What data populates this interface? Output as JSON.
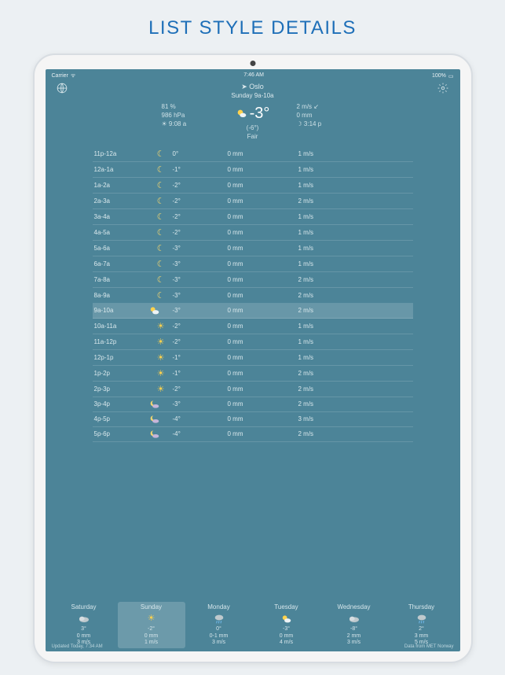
{
  "promo_title": "LIST STYLE DETAILS",
  "status_bar": {
    "carrier": "Carrier",
    "time": "7:46 AM",
    "battery": "100%"
  },
  "header": {
    "location": "Oslo",
    "period": "Sunday 9a-10a"
  },
  "summary": {
    "left": {
      "humidity": "81 %",
      "pressure": "986 hPa",
      "sunrise": "☀ 9:08 a"
    },
    "center": {
      "temp": "-3°",
      "feels": "(-6°)",
      "cond": "Fair"
    },
    "right": {
      "wind": "2 m/s ↙",
      "precip": "0 mm",
      "sunset": "☽ 3:14 p"
    }
  },
  "hours": [
    {
      "t": "11p-12a",
      "icon": "moon",
      "temp": "0°",
      "p": "0 mm",
      "w": "1 m/s"
    },
    {
      "t": "12a-1a",
      "icon": "moon",
      "temp": "-1°",
      "p": "0 mm",
      "w": "1 m/s"
    },
    {
      "t": "1a-2a",
      "icon": "moon",
      "temp": "-2°",
      "p": "0 mm",
      "w": "1 m/s"
    },
    {
      "t": "2a-3a",
      "icon": "moon",
      "temp": "-2°",
      "p": "0 mm",
      "w": "2 m/s"
    },
    {
      "t": "3a-4a",
      "icon": "moon",
      "temp": "-2°",
      "p": "0 mm",
      "w": "1 m/s"
    },
    {
      "t": "4a-5a",
      "icon": "moon",
      "temp": "-2°",
      "p": "0 mm",
      "w": "1 m/s"
    },
    {
      "t": "5a-6a",
      "icon": "moon",
      "temp": "-3°",
      "p": "0 mm",
      "w": "1 m/s"
    },
    {
      "t": "6a-7a",
      "icon": "moon",
      "temp": "-3°",
      "p": "0 mm",
      "w": "1 m/s"
    },
    {
      "t": "7a-8a",
      "icon": "moon",
      "temp": "-3°",
      "p": "0 mm",
      "w": "2 m/s"
    },
    {
      "t": "8a-9a",
      "icon": "moon",
      "temp": "-3°",
      "p": "0 mm",
      "w": "2 m/s"
    },
    {
      "t": "9a-10a",
      "icon": "suncloud",
      "temp": "-3°",
      "p": "0 mm",
      "w": "2 m/s",
      "sel": true
    },
    {
      "t": "10a-11a",
      "icon": "sun",
      "temp": "-2°",
      "p": "0 mm",
      "w": "1 m/s"
    },
    {
      "t": "11a-12p",
      "icon": "sun",
      "temp": "-2°",
      "p": "0 mm",
      "w": "1 m/s"
    },
    {
      "t": "12p-1p",
      "icon": "sun",
      "temp": "-1°",
      "p": "0 mm",
      "w": "1 m/s"
    },
    {
      "t": "1p-2p",
      "icon": "sun",
      "temp": "-1°",
      "p": "0 mm",
      "w": "2 m/s"
    },
    {
      "t": "2p-3p",
      "icon": "sun",
      "temp": "-2°",
      "p": "0 mm",
      "w": "2 m/s"
    },
    {
      "t": "3p-4p",
      "icon": "moonset",
      "temp": "-3°",
      "p": "0 mm",
      "w": "2 m/s"
    },
    {
      "t": "4p-5p",
      "icon": "moonset",
      "temp": "-4°",
      "p": "0 mm",
      "w": "3 m/s"
    },
    {
      "t": "5p-6p",
      "icon": "moonset",
      "temp": "-4°",
      "p": "0 mm",
      "w": "2 m/s"
    }
  ],
  "days": [
    {
      "name": "Saturday",
      "icon": "cloud",
      "temp": "3°",
      "p": "0 mm",
      "w": "3 m/s"
    },
    {
      "name": "Sunday",
      "icon": "sun",
      "temp": "-2°",
      "p": "0 mm",
      "w": "1 m/s",
      "sel": true
    },
    {
      "name": "Monday",
      "icon": "rain",
      "temp": "0°",
      "p": "0-1 mm",
      "w": "3 m/s"
    },
    {
      "name": "Tuesday",
      "icon": "suncloud",
      "temp": "-3°",
      "p": "0 mm",
      "w": "4 m/s"
    },
    {
      "name": "Wednesday",
      "icon": "cloud",
      "temp": "-8°",
      "p": "2 mm",
      "w": "3 m/s"
    },
    {
      "name": "Thursday",
      "icon": "rain",
      "temp": "2°",
      "p": "3 mm",
      "w": "5 m/s"
    }
  ],
  "footer": {
    "left": "Updated Today, 7:34 AM",
    "right": "Data from MET Norway"
  }
}
